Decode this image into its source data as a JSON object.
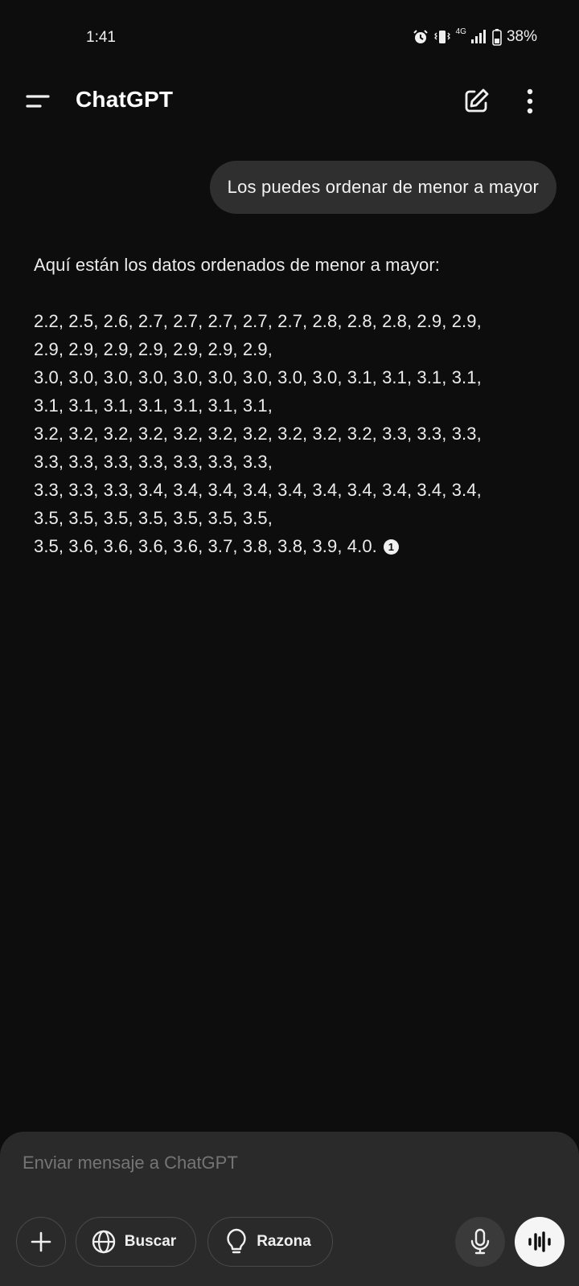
{
  "status_bar": {
    "time": "1:41",
    "network": "4G",
    "battery": "38%",
    "icons": [
      "alarm-icon",
      "vibrate-icon",
      "signal-icon",
      "battery-icon"
    ]
  },
  "header": {
    "title": "ChatGPT",
    "icons": [
      "menu-icon",
      "new-chat-icon",
      "more-options-icon"
    ]
  },
  "conversation": {
    "user_message": "Los puedes ordenar de menor a mayor",
    "assistant": {
      "intro": "Aquí están los datos ordenados de menor a mayor:",
      "lines": [
        "2.2, 2.5, 2.6, 2.7, 2.7, 2.7, 2.7, 2.7, 2.8, 2.8, 2.8, 2.9, 2.9,",
        "2.9, 2.9, 2.9, 2.9, 2.9, 2.9, 2.9,",
        "3.0, 3.0, 3.0, 3.0, 3.0, 3.0, 3.0, 3.0, 3.0, 3.1, 3.1, 3.1, 3.1,",
        "3.1, 3.1, 3.1, 3.1, 3.1, 3.1, 3.1,",
        "3.2, 3.2, 3.2, 3.2, 3.2, 3.2, 3.2, 3.2, 3.2, 3.2, 3.3, 3.3, 3.3,",
        "3.3, 3.3, 3.3, 3.3, 3.3, 3.3, 3.3,",
        "3.3, 3.3, 3.3, 3.4, 3.4, 3.4, 3.4, 3.4, 3.4, 3.4, 3.4, 3.4, 3.4,",
        "3.5, 3.5, 3.5, 3.5, 3.5, 3.5, 3.5,",
        "3.5, 3.6, 3.6, 3.6, 3.6, 3.7, 3.8, 3.8, 3.9, 4.0."
      ],
      "citation": "1"
    }
  },
  "composer": {
    "placeholder": "Enviar mensaje a ChatGPT",
    "search_label": "Buscar",
    "reason_label": "Razona",
    "icons": [
      "plus-icon",
      "globe-icon",
      "lightbulb-icon",
      "microphone-icon",
      "voice-mode-icon"
    ]
  },
  "colors": {
    "background": "#0d0d0d",
    "bubble": "#2f2f2f",
    "composer": "#2a2a2a",
    "text": "#ececec"
  }
}
